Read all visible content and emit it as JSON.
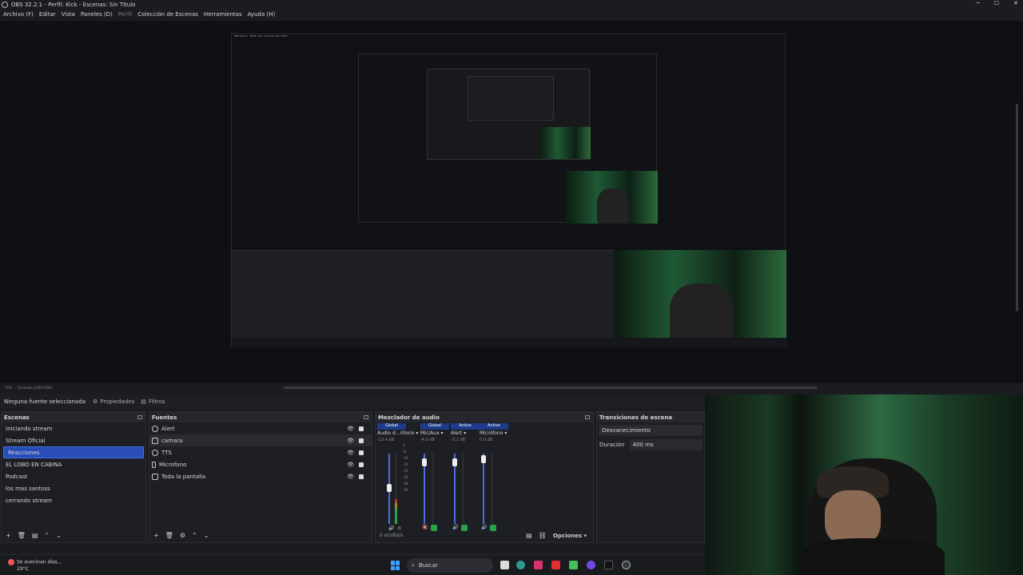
{
  "window": {
    "title": "OBS 32.2.1 - Perfil: Kick - Escenas: Sin Título",
    "controls": [
      "─",
      "☐",
      "✕"
    ]
  },
  "menu": [
    "Archivo (F)",
    "Editar",
    "Vista",
    "Paneles (D)",
    "Perfil",
    "Colección de Escenas",
    "Herramientas",
    "Ayuda (H)"
  ],
  "status": {
    "zoom": "72%",
    "scale": "Escalado (1367x780)"
  },
  "props": {
    "no_source": "Ninguna fuente seleccionada",
    "properties": "Propiedades",
    "filters": "Filtros"
  },
  "scenes": {
    "title": "Escenas",
    "items": [
      "Iniciando stream",
      "Stream Oficial",
      "Reacciones",
      "EL LOBO EN CABINA",
      "Podcast",
      "los mas santoss",
      "cerrando stream"
    ],
    "active_index": 2
  },
  "sources": {
    "title": "Fuentes",
    "items": [
      "Alert",
      "camara",
      "TTS",
      "Microfono",
      "Toda la pantalla"
    ]
  },
  "mixer": {
    "title": "Mezclador de audio",
    "channels": [
      {
        "head": "Global",
        "name": "Audio d...ritorio",
        "db": "-13.4 dB",
        "level": 0.35
      },
      {
        "head": "Global",
        "name": "Mic/Aux",
        "db": "-4.0 dB",
        "level": 0.0
      },
      {
        "head": "Activo",
        "name": "Alert",
        "db": "-3.1 dB",
        "level": 0.0
      },
      {
        "head": "Activo",
        "name": "Micrófono",
        "db": "0.0 dB",
        "level": 0.0
      }
    ],
    "scale": [
      "0",
      "-4",
      "-8",
      "-12",
      "-16",
      "-20",
      "-24",
      "-28",
      "-32",
      "-36",
      "-40",
      "-44",
      "-48",
      "-52",
      "-56",
      "-60"
    ],
    "hidden": "0 oculto/s",
    "options": "Opciones"
  },
  "transitions": {
    "title": "Transiciones de escena",
    "fade": "Desvanecimiento",
    "duration_label": "Duración",
    "duration": "400 ms"
  },
  "taskbar": {
    "weather": "Se avecinan días...",
    "temp": "29°C",
    "search": "Buscar"
  }
}
